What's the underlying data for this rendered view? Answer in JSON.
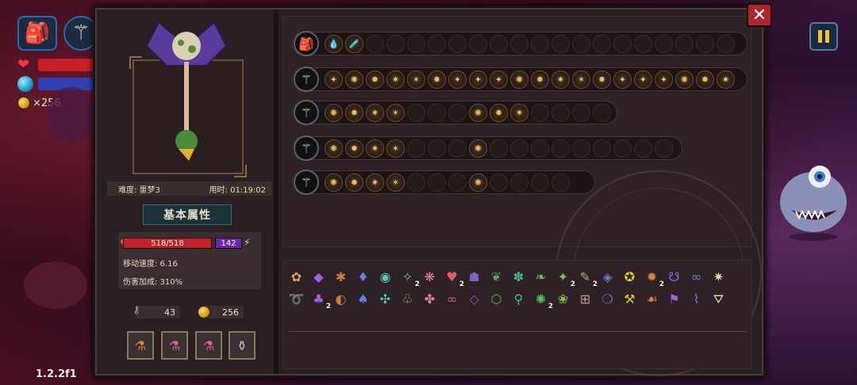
{
  "hud": {
    "gold": "×256",
    "version": "1.2.2f1"
  },
  "panel": {
    "difficulty": "难度: 噩梦3",
    "time": "用时: 01:19:02",
    "section_title": "基本属性",
    "hp": "518/518",
    "mana": "142",
    "move_speed": "移动速度: 6.16",
    "damage_bonus": "伤害加成: 310%",
    "keys": "43",
    "coins": "256"
  },
  "potions": [
    {
      "icon": "potion-orange-icon",
      "glyph": "⚗"
    },
    {
      "icon": "potion-pink-icon",
      "glyph": "⚗"
    },
    {
      "icon": "potion-pink-icon",
      "glyph": "⚗"
    },
    {
      "icon": "jar-icon",
      "glyph": "⚱"
    }
  ],
  "wand_rows": [
    {
      "weapon": "backpack",
      "glyph": "🎒",
      "spells": [
        "💧",
        "🧪",
        "",
        "",
        "",
        "",
        "",
        "",
        "",
        "",
        "",
        "",
        "",
        "",
        "",
        "",
        "",
        "",
        "",
        "",
        "",
        ""
      ]
    },
    {
      "weapon": "wand-1",
      "glyph": "⚚",
      "spells": [
        "✦",
        "✺",
        "✹",
        "✷",
        "✶",
        "✸",
        "✦",
        "✦",
        "✦",
        "✺",
        "✹",
        "✷",
        "✶",
        "✸",
        "✦",
        "✦",
        "✦",
        "✺",
        "✹",
        "✷",
        "✶",
        "✸",
        "✦",
        "✦",
        "✦",
        "✺"
      ]
    },
    {
      "weapon": "wand-2",
      "glyph": "⚚",
      "spells": [
        "✺",
        "✹",
        "✷",
        "✶",
        "",
        "",
        "",
        "✺",
        "✹",
        "✷",
        "",
        "",
        "",
        ""
      ]
    },
    {
      "weapon": "wand-3",
      "glyph": "⚚",
      "spells": [
        "✺",
        "✹",
        "✷",
        "✶",
        "",
        "",
        "",
        "✺",
        "",
        "",
        "",
        "",
        "",
        "",
        "",
        "",
        ""
      ]
    },
    {
      "weapon": "wand-4",
      "glyph": "⚚",
      "spells": [
        "✺",
        "✹",
        "✷",
        "✶",
        "",
        "",
        "",
        "✺",
        "",
        "",
        "",
        ""
      ]
    }
  ],
  "inventory": {
    "row1": [
      {
        "glyph": "✿",
        "count": ""
      },
      {
        "glyph": "◆",
        "count": ""
      },
      {
        "glyph": "✱",
        "count": ""
      },
      {
        "glyph": "♦",
        "count": ""
      },
      {
        "glyph": "◉",
        "count": ""
      },
      {
        "glyph": "✧",
        "count": "2"
      },
      {
        "glyph": "❋",
        "count": ""
      },
      {
        "glyph": "♥",
        "count": "2"
      },
      {
        "glyph": "☗",
        "count": ""
      },
      {
        "glyph": "❦",
        "count": ""
      },
      {
        "glyph": "✽",
        "count": ""
      },
      {
        "glyph": "❧",
        "count": ""
      },
      {
        "glyph": "✦",
        "count": "2"
      },
      {
        "glyph": "✎",
        "count": "2"
      },
      {
        "glyph": "◈",
        "count": ""
      },
      {
        "glyph": "✪",
        "count": ""
      },
      {
        "glyph": "✹",
        "count": "2"
      },
      {
        "glyph": "☋",
        "count": ""
      },
      {
        "glyph": "∞",
        "count": ""
      },
      {
        "glyph": "✷",
        "count": ""
      }
    ],
    "row2": [
      {
        "glyph": "➰",
        "count": ""
      },
      {
        "glyph": "♣",
        "count": "2"
      },
      {
        "glyph": "◐",
        "count": ""
      },
      {
        "glyph": "♠",
        "count": ""
      },
      {
        "glyph": "✣",
        "count": ""
      },
      {
        "glyph": "♧",
        "count": ""
      },
      {
        "glyph": "✤",
        "count": ""
      },
      {
        "glyph": "∞",
        "count": ""
      },
      {
        "glyph": "◇",
        "count": ""
      },
      {
        "glyph": "⬡",
        "count": ""
      },
      {
        "glyph": "⚲",
        "count": ""
      },
      {
        "glyph": "✺",
        "count": "2"
      },
      {
        "glyph": "❀",
        "count": ""
      },
      {
        "glyph": "⊞",
        "count": ""
      },
      {
        "glyph": "❍",
        "count": ""
      },
      {
        "glyph": "⚒",
        "count": ""
      },
      {
        "glyph": "☙",
        "count": ""
      },
      {
        "glyph": "⚑",
        "count": ""
      },
      {
        "glyph": "⌇",
        "count": ""
      },
      {
        "glyph": "⛛",
        "count": ""
      }
    ]
  }
}
